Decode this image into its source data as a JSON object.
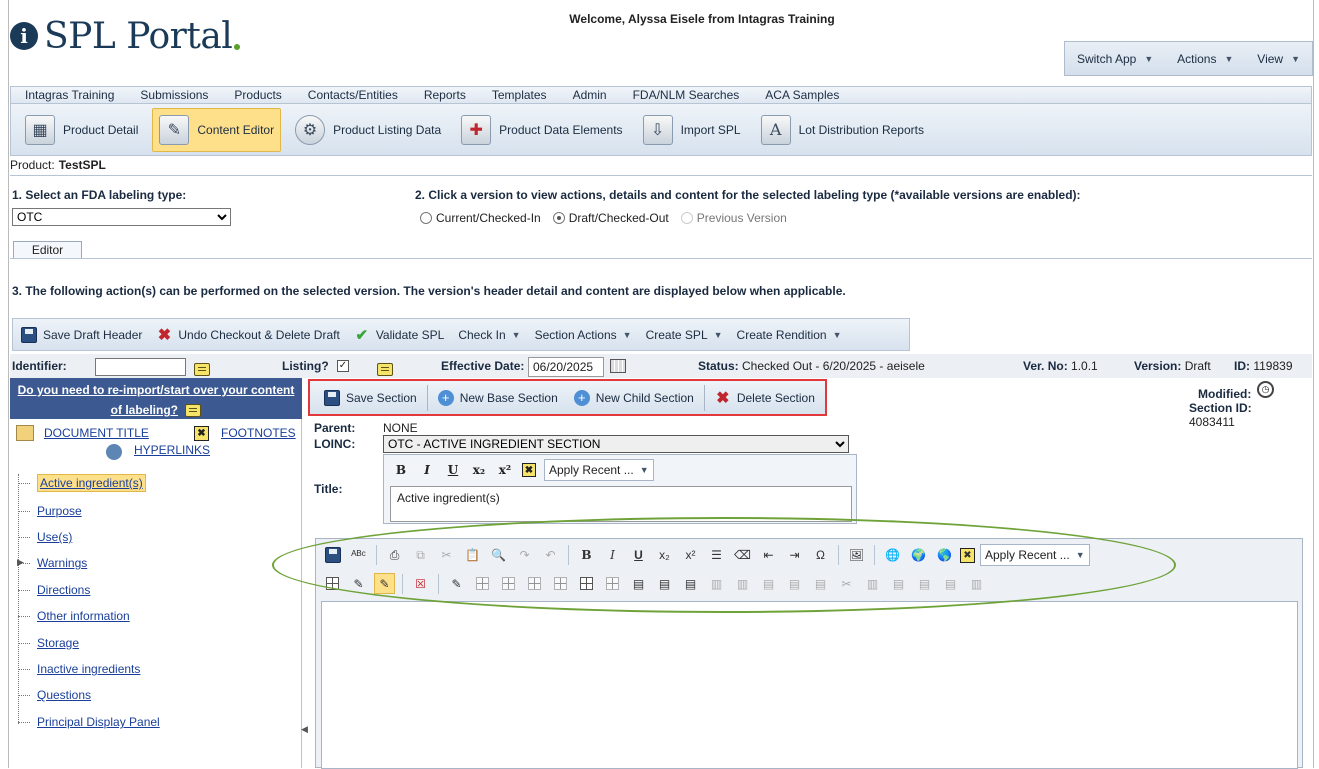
{
  "header": {
    "logo_text": "SPL Portal",
    "welcome": "Welcome, Alyssa Eisele from Intagras Training",
    "top_menu": [
      {
        "label": "Switch App"
      },
      {
        "label": "Actions"
      },
      {
        "label": "View"
      }
    ]
  },
  "nav": {
    "items": [
      "Intagras Training",
      "Submissions",
      "Products",
      "Contacts/Entities",
      "Reports",
      "Templates",
      "Admin",
      "FDA/NLM Searches",
      "ACA Samples"
    ]
  },
  "iconbar": {
    "items": [
      {
        "label": "Product Detail",
        "icon": "product-detail-icon"
      },
      {
        "label": "Content Editor",
        "icon": "content-editor-icon",
        "active": true
      },
      {
        "label": "Product Listing Data",
        "icon": "gears-icon"
      },
      {
        "label": "Product Data Elements",
        "icon": "medical-kit-icon"
      },
      {
        "label": "Import SPL",
        "icon": "import-icon"
      },
      {
        "label": "Lot Distribution Reports",
        "icon": "report-icon"
      }
    ]
  },
  "product": {
    "label": "Product:",
    "name": "TestSPL"
  },
  "step1": {
    "label": "1. Select an FDA labeling type:",
    "selected": "OTC"
  },
  "step2": {
    "label": "2. Click a version to view actions, details and content for the selected labeling type (*available versions are enabled):",
    "options": [
      {
        "label": "Current/Checked-In",
        "checked": false,
        "enabled": true
      },
      {
        "label": "Draft/Checked-Out",
        "checked": true,
        "enabled": true
      },
      {
        "label": "Previous Version",
        "checked": false,
        "enabled": false
      }
    ]
  },
  "tabs": [
    {
      "label": "Editor"
    }
  ],
  "step3": {
    "label": "3. The following action(s) can be performed on the selected version. The version's header detail and content are displayed below when applicable."
  },
  "actions": {
    "save_draft_header": "Save Draft Header",
    "undo_checkout": "Undo Checkout & Delete Draft",
    "validate_spl": "Validate SPL",
    "check_in": "Check In",
    "section_actions": "Section Actions",
    "create_spl": "Create SPL",
    "create_rendition": "Create Rendition"
  },
  "status_row": {
    "identifier_label": "Identifier:",
    "identifier_value": "",
    "listing_label": "Listing?",
    "listing_checked": true,
    "effective_label": "Effective Date:",
    "effective_value": "06/20/2025",
    "status_label": "Status:",
    "status_value": "Checked Out - 6/20/2025 - aeisele",
    "ver_label": "Ver. No:",
    "ver_value": "1.0.1",
    "version_label": "Version:",
    "version_value": "Draft",
    "id_label": "ID:",
    "id_value": "119839"
  },
  "left": {
    "reimport_line1": "Do you need to re-import/start over your content",
    "reimport_line2": "of labeling?",
    "doc_title": "DOCUMENT TITLE",
    "footnotes": "FOOTNOTES",
    "hyperlinks": "HYPERLINKS",
    "sections": [
      {
        "label": "Active ingredient(s)",
        "selected": true
      },
      {
        "label": "Purpose"
      },
      {
        "label": "Use(s)"
      },
      {
        "label": "Warnings",
        "expandable": true
      },
      {
        "label": "Directions"
      },
      {
        "label": "Other information"
      },
      {
        "label": "Storage"
      },
      {
        "label": "Inactive ingredients"
      },
      {
        "label": "Questions"
      },
      {
        "label": "Principal Display Panel"
      }
    ]
  },
  "section_toolbar": {
    "save": "Save Section",
    "new_base": "New Base Section",
    "new_child": "New Child Section",
    "delete": "Delete Section"
  },
  "section": {
    "parent_label": "Parent:",
    "parent_value": "NONE",
    "loinc_label": "LOINC:",
    "loinc_value": "OTC - ACTIVE INGREDIENT SECTION",
    "title_label": "Title:",
    "title_value": "Active ingredient(s)",
    "apply_recent": "Apply Recent ...",
    "modified_label": "Modified:",
    "section_id_label": "Section ID:",
    "section_id_value": "4083411"
  },
  "rich_editor": {
    "apply_recent": "Apply Recent ..."
  },
  "colors": {
    "highlight_box": "#e2383b",
    "ellipse": "#6fa339",
    "accent": "#3c5a91"
  }
}
